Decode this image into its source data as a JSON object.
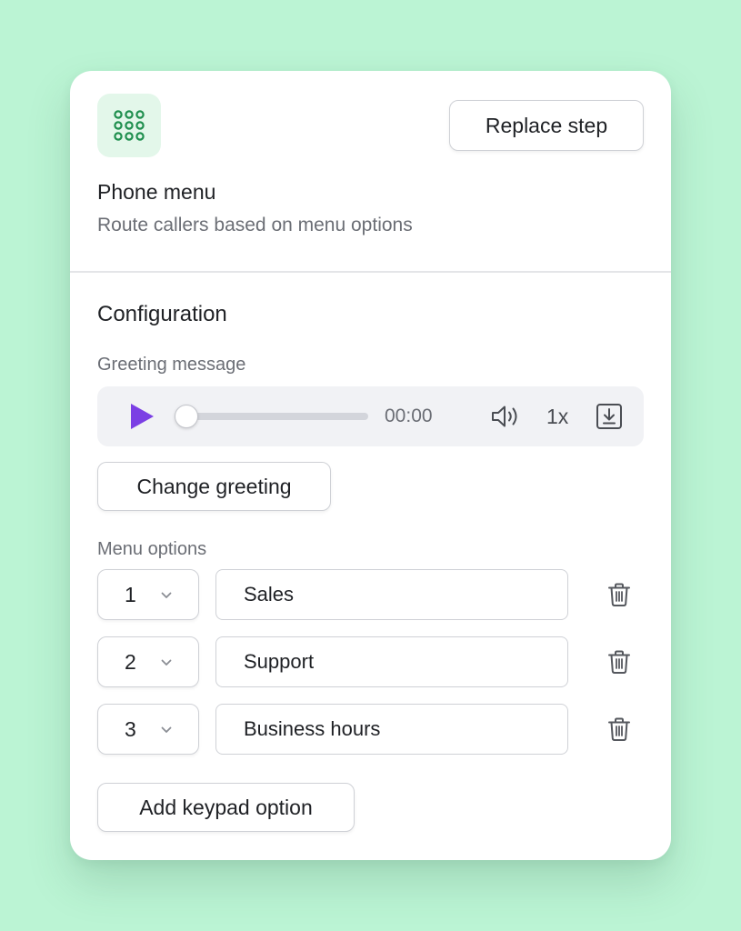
{
  "step": {
    "icon": "keypad-grid-icon",
    "title": "Phone menu",
    "subtitle": "Route callers based on menu options",
    "replace_label": "Replace step"
  },
  "configuration": {
    "title": "Configuration",
    "greeting": {
      "label": "Greeting message",
      "player": {
        "time": "00:00",
        "progress_fraction": 0,
        "speed": "1x",
        "icons": [
          "play-icon",
          "volume-icon",
          "download-icon"
        ]
      },
      "change_label": "Change greeting"
    },
    "menu": {
      "label": "Menu options",
      "options": [
        {
          "key": "1",
          "value": "Sales"
        },
        {
          "key": "2",
          "value": "Support"
        },
        {
          "key": "3",
          "value": "Business hours"
        }
      ],
      "add_label": "Add keypad option"
    }
  },
  "colors": {
    "background": "#bbf4d4",
    "card": "#ffffff",
    "icon_tile": "#e3f7ea",
    "icon_green": "#1f8f4e",
    "play_accent": "#7b3fe4",
    "text_primary": "#1f2125",
    "text_secondary": "#6b6e75",
    "border": "#cfd1d6"
  }
}
